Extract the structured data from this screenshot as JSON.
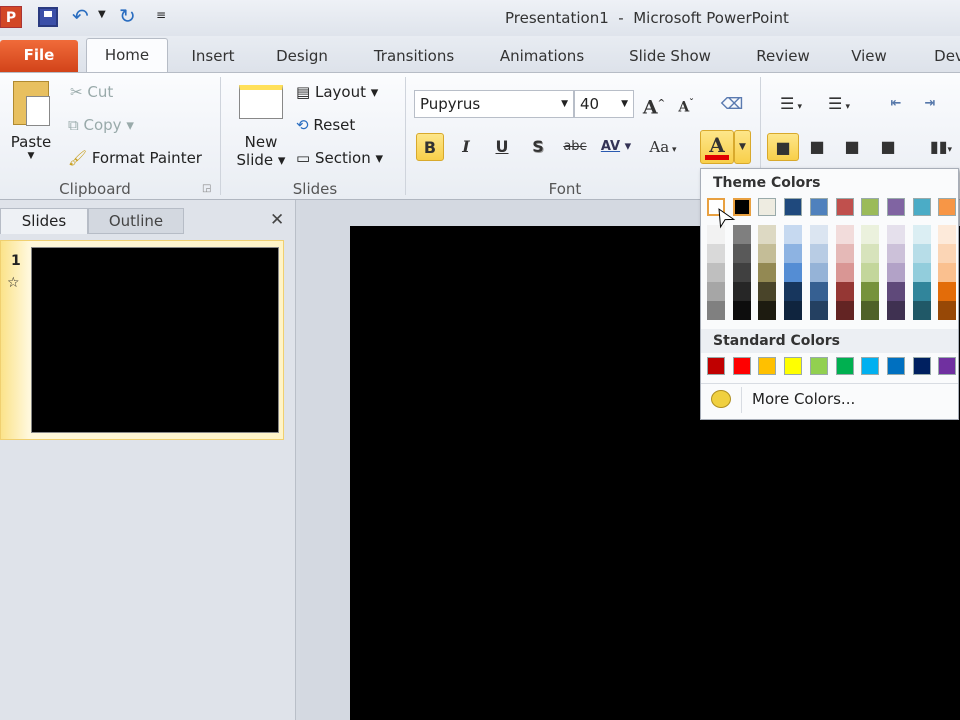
{
  "window": {
    "title": "Presentation1  -  Microsoft PowerPoint"
  },
  "tabs": [
    "File",
    "Home",
    "Insert",
    "Design",
    "Transitions",
    "Animations",
    "Slide Show",
    "Review",
    "View",
    "Dev"
  ],
  "clipboard": {
    "paste": "Paste",
    "cut": "Cut",
    "copy": "Copy",
    "format_painter": "Format Painter",
    "label": "Clipboard"
  },
  "slides_group": {
    "new_slide_1": "New",
    "new_slide_2": "Slide",
    "layout": "Layout",
    "reset": "Reset",
    "section": "Section",
    "label": "Slides"
  },
  "font": {
    "name": "Pupyrus",
    "size": "40",
    "label": "Font",
    "bold": "B",
    "italic": "I",
    "underline": "U",
    "shadow": "S",
    "strike": "abc",
    "spacing": "AV",
    "case": "Aa",
    "color_letter": "A",
    "grow": "A",
    "shrink": "A"
  },
  "pane": {
    "tab_slides": "Slides",
    "tab_outline": "Outline",
    "close": "✕",
    "slide_number": "1",
    "star": "☆"
  },
  "color_menu": {
    "theme_title": "Theme Colors",
    "standard_title": "Standard Colors",
    "more_colors": "More Colors...",
    "theme": [
      "#FFFFFF",
      "#000000",
      "#EEECE1",
      "#1F497D",
      "#4F81BD",
      "#C0504D",
      "#9BBB59",
      "#8064A2",
      "#4BACC6",
      "#F79646"
    ],
    "shades": [
      [
        "#F2F2F2",
        "#D9D9D9",
        "#BFBFBF",
        "#A6A6A6",
        "#808080"
      ],
      [
        "#7F7F7F",
        "#595959",
        "#404040",
        "#262626",
        "#0D0D0D"
      ],
      [
        "#DDD9C3",
        "#C4BD97",
        "#938953",
        "#494429",
        "#1D1B10"
      ],
      [
        "#C6D9F0",
        "#8DB3E2",
        "#548DD4",
        "#17365D",
        "#0F243E"
      ],
      [
        "#DBE5F1",
        "#B8CCE4",
        "#95B3D7",
        "#366092",
        "#244061"
      ],
      [
        "#F2DCDB",
        "#E5B9B7",
        "#D99694",
        "#953734",
        "#632423"
      ],
      [
        "#EBF1DD",
        "#D7E3BC",
        "#C3D69B",
        "#76923C",
        "#4F6128"
      ],
      [
        "#E5E0EC",
        "#CCC1D9",
        "#B2A2C7",
        "#5F497A",
        "#3F3151"
      ],
      [
        "#DBEEF3",
        "#B7DDE8",
        "#92CDDC",
        "#31859B",
        "#205867"
      ],
      [
        "#FDEADA",
        "#FBD5B5",
        "#FAC08F",
        "#E36C09",
        "#974806"
      ]
    ],
    "standard": [
      "#C00000",
      "#FF0000",
      "#FFC000",
      "#FFFF00",
      "#92D050",
      "#00B050",
      "#00B0F0",
      "#0070C0",
      "#002060",
      "#7030A0"
    ]
  }
}
